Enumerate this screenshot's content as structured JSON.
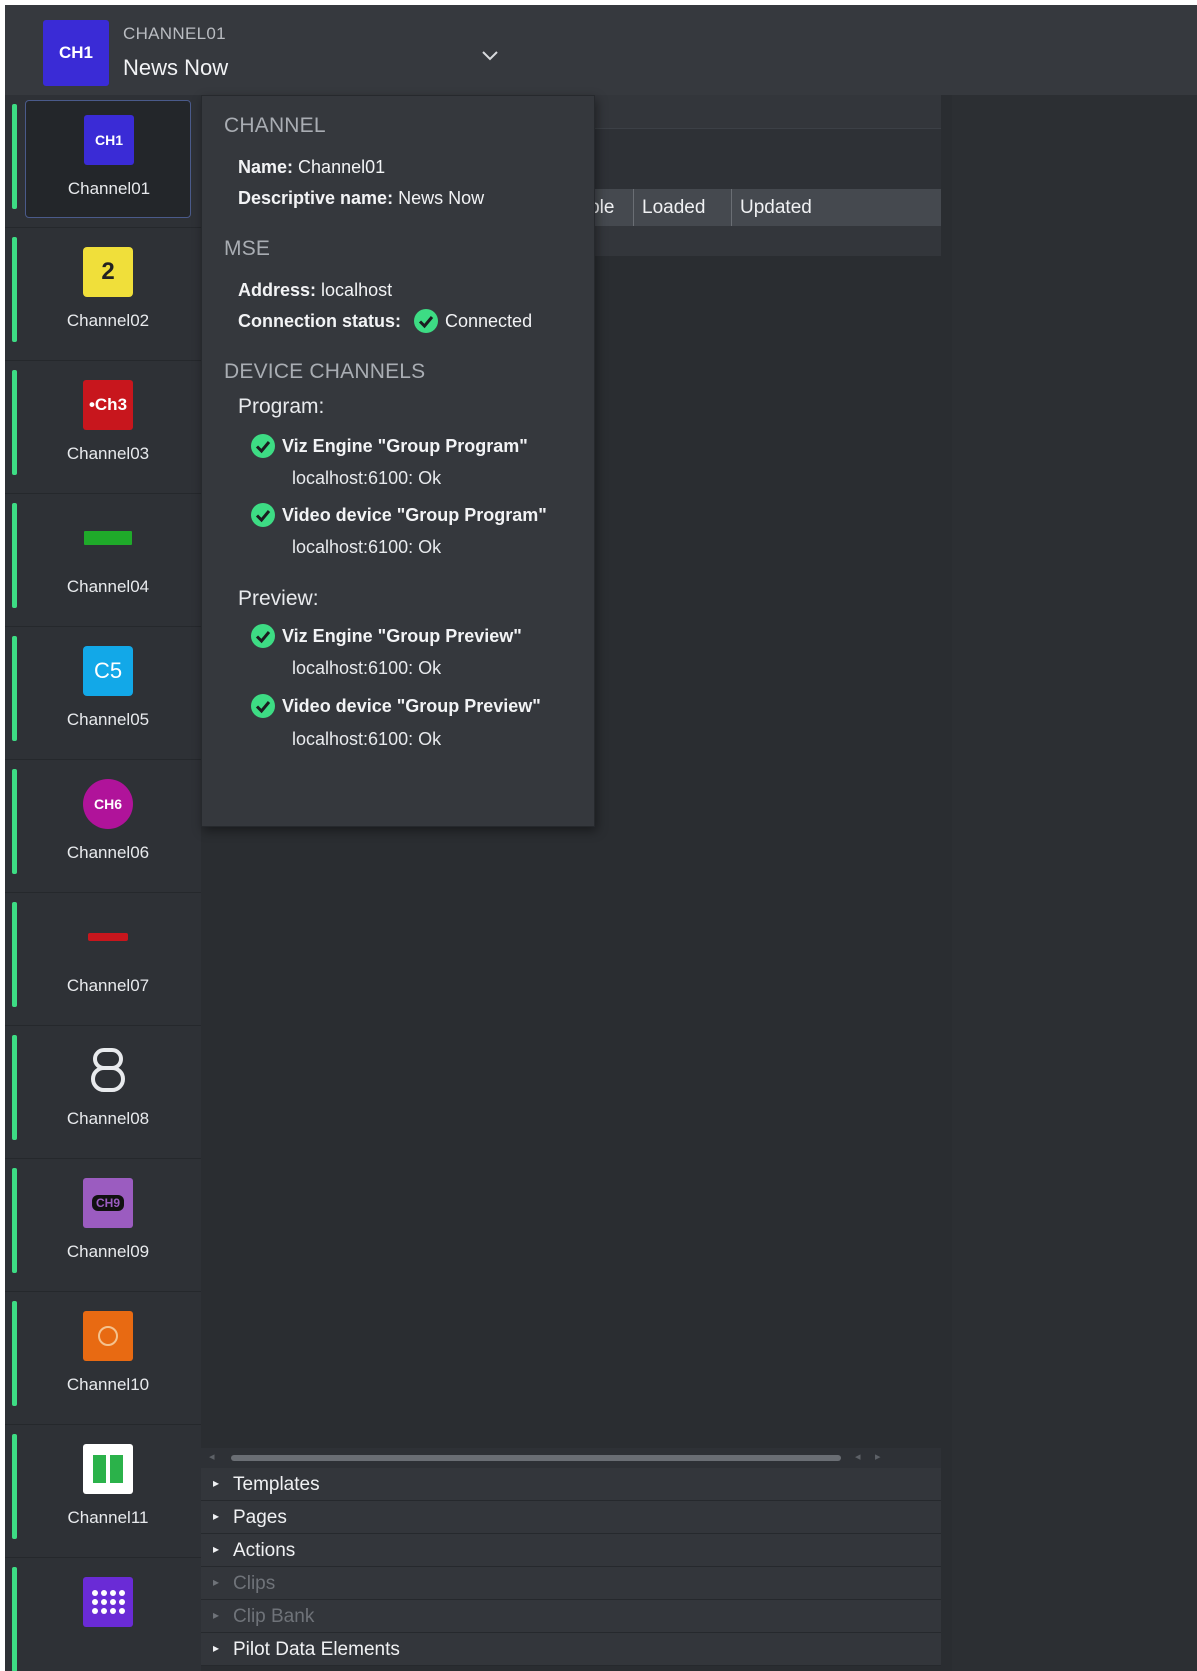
{
  "header": {
    "logo_text": "CH1",
    "channel_code": "CHANNEL01",
    "channel_name": "News Now"
  },
  "sidebar": {
    "items": [
      {
        "label": "Channel01",
        "icon": "ch1-logo",
        "icon_text": "CH1",
        "color": "#3a2bd6",
        "active": true
      },
      {
        "label": "Channel02",
        "icon": "ch2-logo",
        "icon_text": "2",
        "color": "#f0df3a"
      },
      {
        "label": "Channel03",
        "icon": "ch3-logo",
        "icon_text": "•Ch3",
        "color": "#c8161d"
      },
      {
        "label": "Channel04",
        "icon": "ch4-logo",
        "icon_text": "",
        "color": "#1faa2a"
      },
      {
        "label": "Channel05",
        "icon": "ch5-logo",
        "icon_text": "C5",
        "color": "#12a8e8"
      },
      {
        "label": "Channel06",
        "icon": "ch6-logo",
        "icon_text": "CH6",
        "color": "#b0139a"
      },
      {
        "label": "Channel07",
        "icon": "ch7-logo",
        "icon_text": "",
        "color": "#c8161d"
      },
      {
        "label": "Channel08",
        "icon": "ch8-logo",
        "icon_text": "8",
        "color": "#e8eaed"
      },
      {
        "label": "Channel09",
        "icon": "ch9-logo",
        "icon_text": "CH9",
        "color": "#9b5cc0"
      },
      {
        "label": "Channel10",
        "icon": "ch10-logo",
        "icon_text": "",
        "color": "#e86a12"
      },
      {
        "label": "Channel11",
        "icon": "ch11-logo",
        "icon_text": "",
        "color": "#2bb24a"
      },
      {
        "label": "",
        "icon": "ch12-logo",
        "icon_text": "",
        "color": "#6a2bd6"
      }
    ]
  },
  "table": {
    "columns": [
      "vailable",
      "Loaded",
      "Updated"
    ]
  },
  "accordions": [
    {
      "label": "Templates",
      "enabled": true
    },
    {
      "label": "Pages",
      "enabled": true
    },
    {
      "label": "Actions",
      "enabled": true
    },
    {
      "label": "Clips",
      "enabled": false
    },
    {
      "label": "Clip Bank",
      "enabled": false
    },
    {
      "label": "Pilot Data Elements",
      "enabled": true
    }
  ],
  "popup": {
    "channel_title": "CHANNEL",
    "name_key": "Name:",
    "name_value": "Channel01",
    "desc_key": "Descriptive name:",
    "desc_value": "News Now",
    "mse_title": "MSE",
    "address_key": "Address:",
    "address_value": "localhost",
    "conn_key": "Connection status:",
    "conn_value": "Connected",
    "device_title": "DEVICE CHANNELS",
    "program_title": "Program:",
    "preview_title": "Preview:",
    "program_devices": [
      {
        "name": "Viz Engine \"Group Program\"",
        "status": "localhost:6100: Ok"
      },
      {
        "name": "Video device \"Group Program\"",
        "status": "localhost:6100: Ok"
      }
    ],
    "preview_devices": [
      {
        "name": "Viz Engine \"Group Preview\"",
        "status": "localhost:6100: Ok"
      },
      {
        "name": "Video device \"Group Preview\"",
        "status": "localhost:6100: Ok"
      }
    ]
  },
  "colors": {
    "accent_green": "#3ddc84",
    "check_green": "#3ddc84"
  }
}
